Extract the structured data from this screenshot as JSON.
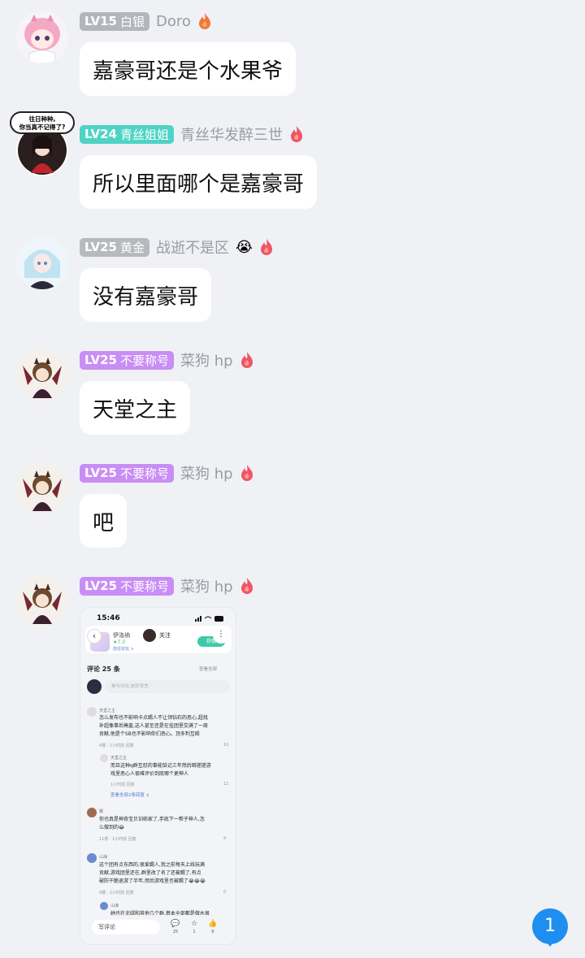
{
  "messages": [
    {
      "level": "LV15",
      "title": "白银",
      "nick": "Doro",
      "text": "嘉豪哥还是个水果爷"
    },
    {
      "level": "LV24",
      "title": "青丝姐姐",
      "nick": "青丝华发醉三世",
      "text": "所以里面哪个是嘉豪哥"
    },
    {
      "level": "LV25",
      "title": "黄金",
      "nick": "战逝不是区",
      "nick_emoji": "😭",
      "text": "没有嘉豪哥"
    },
    {
      "level": "LV25",
      "title": "不要称号",
      "nick": "菜狗 hp",
      "text": "天堂之主"
    },
    {
      "level": "LV25",
      "title": "不要称号",
      "nick": "菜狗 hp",
      "text": "吧"
    },
    {
      "level": "LV25",
      "title": "不要称号",
      "nick": "菜狗 hp"
    }
  ],
  "avatar_bubble_text": "往日种种,\n你当真不记得了?",
  "screenshot": {
    "time": "15:46",
    "game_name": "伊洛纳",
    "game_score": "★7.3",
    "forum_link": "前往论坛 >",
    "follow_label": "关注",
    "download_label": "获取",
    "comments_header": "评论 25 条",
    "view_all": "查看全部",
    "input_placeholder": "参与讨论,友好发言",
    "comments": [
      {
        "name": "天堂之主",
        "text1": "怎么发布也不影响卡点踢人不让领钻石的恶心,超找",
        "text2": "补超像事后掩盖,这人甚至还是在挂团里交满了一周",
        "text3": "贡献,他是个SB也不影响你们恶心。顶多判互殴",
        "meta": "4楼 · 1小时前 回复",
        "like": "16"
      },
      {
        "name": "天堂之主",
        "text1": "而且这种q群互怼的事能馅记三年然后暗搓搓游",
        "text2": "戏里恶心人很难评价到底哪个更神人",
        "meta": "1小时前 回复",
        "like": "12"
      },
      {
        "name": "翼",
        "text1": "你也真是神奇宝贝训练家了,手底下一帮子神人,怎",
        "text2": "么做到的😂",
        "meta": "11楼 · 1小时前 回复",
        "like": "9"
      },
      {
        "name": "山海",
        "text1": "这个团有点东西的,很爱踢人,我之前每天上线玩满",
        "text2": "贡献,游戏团里还在,群里改了名了还被踢了,有点",
        "text3": "破防干脆退游了半年,然后游戏里也被踢了😭😭😭",
        "meta": "9楼 · 1小时前 回复",
        "like": "0"
      },
      {
        "name": "山海",
        "text1": "她也在北绿和其他几个群,基本全部都是做水很"
      }
    ],
    "more_replies": "查看全部2条回复 ∨",
    "write_comment": "写评论",
    "actions": [
      {
        "icon": "💬",
        "count": "25"
      },
      {
        "icon": "☆",
        "count": "1"
      },
      {
        "icon": "👍",
        "count": "6"
      }
    ]
  },
  "unread_count": "1",
  "colors": {
    "silver": "#b3b6bd",
    "teal": "#4fd3c5",
    "purple": "#c88ef5",
    "unread": "#1e8ff0"
  }
}
